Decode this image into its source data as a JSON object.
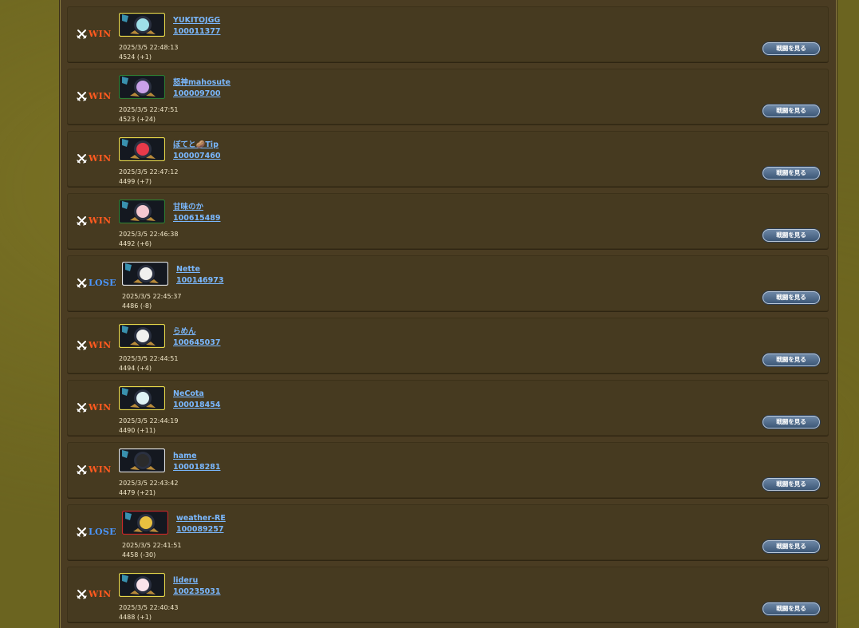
{
  "button_label": "戦闘を見る",
  "colors": {
    "win": "#ff5a1f",
    "lose": "#4a96ff",
    "link": "#7ab8ff",
    "row_bg": "#463a20"
  },
  "battles": [
    {
      "result": "WIN",
      "name": "YUKITOJGG",
      "id": "100011377",
      "time": "2025/3/5 22:48:13",
      "score": "4524 (+1)",
      "frame": "#e8d84a",
      "icon": "character-portrait-icon"
    },
    {
      "result": "WIN",
      "name": "怒神mahosute",
      "id": "100009700",
      "time": "2025/3/5 22:47:51",
      "score": "4523 (+24)",
      "frame": "#2e7d32",
      "icon": "character-portrait-icon"
    },
    {
      "result": "WIN",
      "name": "ぼてと🥔Tip",
      "id": "100007460",
      "time": "2025/3/5 22:47:12",
      "score": "4499 (+7)",
      "frame": "#e8d84a",
      "icon": "character-portrait-icon"
    },
    {
      "result": "WIN",
      "name": "甘味のか",
      "id": "100615489",
      "time": "2025/3/5 22:46:38",
      "score": "4492 (+6)",
      "frame": "#2e7d32",
      "icon": "character-portrait-icon"
    },
    {
      "result": "LOSE",
      "name": "Nette",
      "id": "100146973",
      "time": "2025/3/5 22:45:37",
      "score": "4486 (-8)",
      "frame": "#e0e0e0",
      "icon": "character-portrait-icon"
    },
    {
      "result": "WIN",
      "name": "らめん",
      "id": "100645037",
      "time": "2025/3/5 22:44:51",
      "score": "4494 (+4)",
      "frame": "#e8d84a",
      "icon": "character-portrait-icon"
    },
    {
      "result": "WIN",
      "name": "NeCota",
      "id": "100018454",
      "time": "2025/3/5 22:44:19",
      "score": "4490 (+11)",
      "frame": "#e8d84a",
      "icon": "character-portrait-icon"
    },
    {
      "result": "WIN",
      "name": "hame",
      "id": "100018281",
      "time": "2025/3/5 22:43:42",
      "score": "4479 (+21)",
      "frame": "#e0e0e0",
      "icon": "character-portrait-icon"
    },
    {
      "result": "LOSE",
      "name": "weather-RE",
      "id": "100089257",
      "time": "2025/3/5 22:41:51",
      "score": "4458 (-30)",
      "frame": "#c62828",
      "icon": "character-portrait-icon"
    },
    {
      "result": "WIN",
      "name": "lideru",
      "id": "100235031",
      "time": "2025/3/5 22:40:43",
      "score": "4488 (+1)",
      "frame": "#e8d84a",
      "icon": "character-portrait-icon"
    }
  ]
}
